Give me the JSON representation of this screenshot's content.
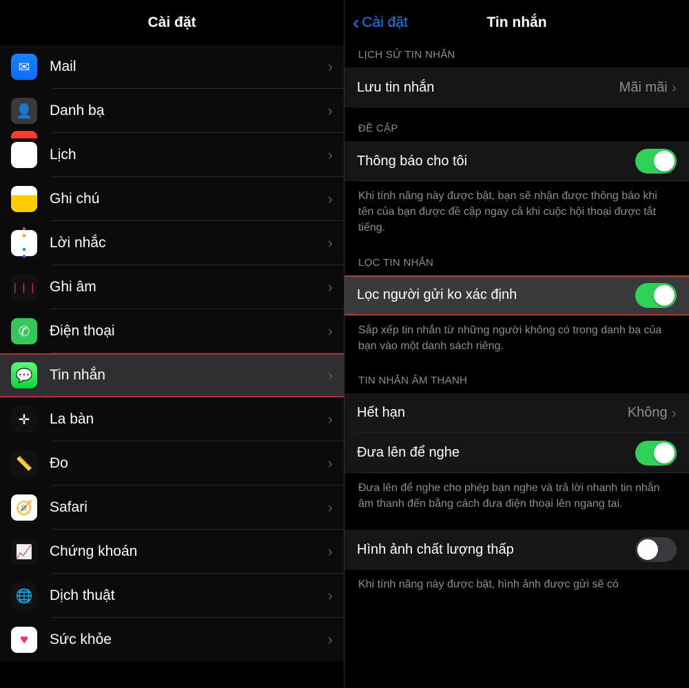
{
  "left": {
    "title": "Cài đặt",
    "items": [
      {
        "id": "mail",
        "label": "Mail",
        "iconClass": "bg-blue",
        "glyph": "✉︎"
      },
      {
        "id": "contacts",
        "label": "Danh bạ",
        "iconClass": "bg-gray",
        "glyph": "👤"
      },
      {
        "id": "calendar",
        "label": "Lịch",
        "iconClass": "bg-white",
        "glyph": "📅"
      },
      {
        "id": "notes",
        "label": "Ghi chú",
        "iconClass": "bg-yellow",
        "glyph": ""
      },
      {
        "id": "reminders",
        "label": "Lời nhắc",
        "iconClass": "bg-white",
        "glyph": "●"
      },
      {
        "id": "voicememo",
        "label": "Ghi âm",
        "iconClass": "bg-black",
        "glyph": "❘❘❘"
      },
      {
        "id": "phone",
        "label": "Điện thoại",
        "iconClass": "bg-phone",
        "glyph": "✆"
      },
      {
        "id": "messages",
        "label": "Tin nhắn",
        "iconClass": "bg-msg",
        "glyph": "💬",
        "selected": true
      },
      {
        "id": "compass",
        "label": "La bàn",
        "iconClass": "bg-black",
        "glyph": "✛"
      },
      {
        "id": "measure",
        "label": "Đo",
        "iconClass": "bg-black",
        "glyph": "📏"
      },
      {
        "id": "safari",
        "label": "Safari",
        "iconClass": "bg-safari",
        "glyph": "🧭"
      },
      {
        "id": "stocks",
        "label": "Chứng khoán",
        "iconClass": "bg-black",
        "glyph": "📈"
      },
      {
        "id": "translate",
        "label": "Dịch thuật",
        "iconClass": "bg-black",
        "glyph": "🌐"
      },
      {
        "id": "health",
        "label": "Sức khỏe",
        "iconClass": "bg-white",
        "glyph": "♥"
      }
    ]
  },
  "right": {
    "back": "Cài đặt",
    "title": "Tin nhắn",
    "sections": {
      "history": {
        "header": "LỊCH SỬ TIN NHẮN",
        "keepRow": {
          "label": "Lưu tin nhắn",
          "value": "Mãi mãi"
        }
      },
      "mentions": {
        "header": "ĐỀ CẬP",
        "notifyRow": {
          "label": "Thông báo cho tôi",
          "on": true
        },
        "footer": "Khi tính năng này được bật, bạn sẽ nhận được thông báo khi tên của bạn được đề cập ngay cả khi cuộc hội thoại được tắt tiếng."
      },
      "filter": {
        "header": "LỌC TIN NHẮN",
        "filterRow": {
          "label": "Lọc người gửi ko xác định",
          "on": true,
          "highlight": true
        },
        "footer": "Sắp xếp tin nhắn từ những người không có trong danh bạ của bạn vào một danh sách riêng."
      },
      "audio": {
        "header": "TIN NHẮN ÂM THANH",
        "expireRow": {
          "label": "Hết hạn",
          "value": "Không"
        },
        "raiseRow": {
          "label": "Đưa lên để nghe",
          "on": true
        },
        "footer": "Đưa lên để nghe cho phép bạn nghe và trả lời nhanh tin nhắn âm thanh đến bằng cách đưa điện thoại lên ngang tai."
      },
      "low": {
        "lowRow": {
          "label": "Hình ảnh chất lượng thấp",
          "on": false
        },
        "footer": "Khi tính năng này được bật, hình ảnh được gửi sẽ có"
      }
    }
  }
}
